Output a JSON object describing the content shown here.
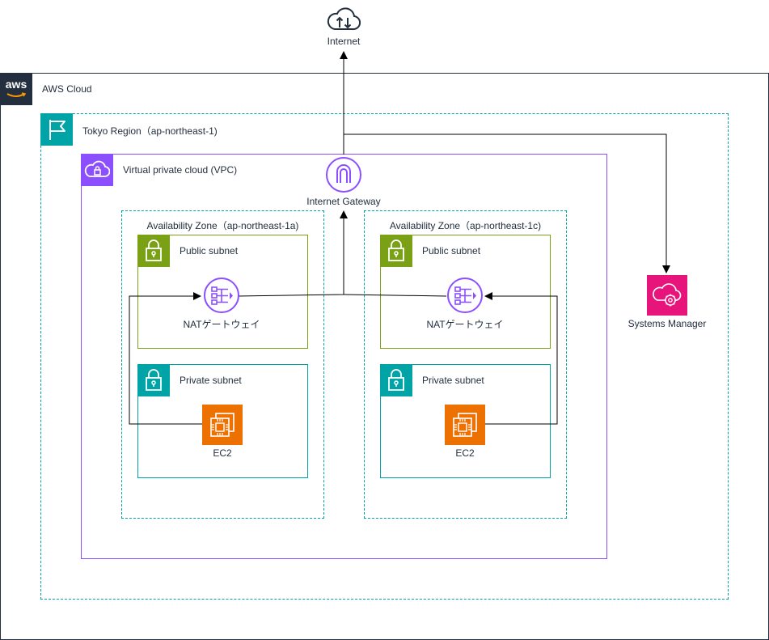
{
  "internet": {
    "label": "Internet"
  },
  "aws_cloud": {
    "label": "AWS Cloud",
    "logo_text": "aws"
  },
  "region": {
    "label": "Tokyo Region（ap-northeast-1)"
  },
  "vpc": {
    "label": "Virtual private cloud (VPC)"
  },
  "igw": {
    "label": "Internet Gateway"
  },
  "az_a": {
    "label": "Availability Zone（ap-northeast-1a)",
    "public_subnet": "Public subnet",
    "private_subnet": "Private subnet",
    "nat": "NATゲートウェイ",
    "ec2": "EC2"
  },
  "az_c": {
    "label": "Availability Zone（ap-northeast-1c)",
    "public_subnet": "Public subnet",
    "private_subnet": "Private subnet",
    "nat": "NATゲートウェイ",
    "ec2": "EC2"
  },
  "ssm": {
    "label": "Systems Manager"
  },
  "colors": {
    "cloud_border": "#232f3e",
    "region_teal": "#00a4a6",
    "vpc_purple": "#8c4fff",
    "public_green": "#7aa116",
    "private_teal": "#00a4a6",
    "ec2_orange": "#ed7100",
    "ssm_pink": "#e7157b",
    "line": "#000000"
  },
  "icons": {
    "internet": "cloud-updown-icon",
    "cloud": "aws-logo-icon",
    "region": "flag-icon",
    "vpc": "vpc-cloud-lock-icon",
    "subnet": "padlock-icon",
    "igw": "internet-gateway-icon",
    "nat": "nat-gateway-icon",
    "ec2": "ec2-chip-icon",
    "ssm": "systems-manager-icon"
  }
}
